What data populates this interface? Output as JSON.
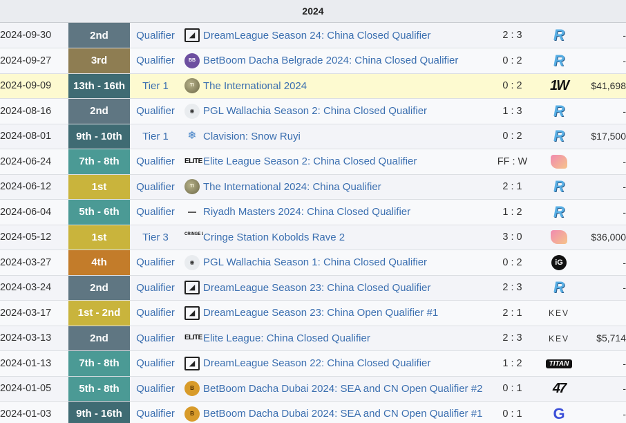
{
  "header": {
    "year": "2024"
  },
  "rows": [
    {
      "date": "2024-09-30",
      "place": "2nd",
      "place_class": "p-2nd",
      "tier": "Qualifier",
      "logo_class": "dl",
      "logo_icon": "dreamleague-icon",
      "logo_glyph": "◢",
      "name": "DreamLeague Season 24: China Closed Qualifier",
      "score": "2 : 3",
      "opp_class": "azure",
      "opp_icon": "azure-ray-logo-icon",
      "opp_glyph": "R",
      "prize": "-"
    },
    {
      "date": "2024-09-27",
      "place": "3rd",
      "place_class": "p-3rd",
      "tier": "Qualifier",
      "logo_class": "bb2",
      "logo_icon": "betboom-dacha-icon",
      "logo_glyph": "BB",
      "name": "BetBoom Dacha Belgrade 2024: China Closed Qualifier",
      "score": "0 : 2",
      "opp_class": "azure",
      "opp_icon": "azure-ray-logo-icon",
      "opp_glyph": "R",
      "prize": "-"
    },
    {
      "date": "2024-09-09",
      "place": "13th - 16th",
      "place_class": "p-dark",
      "tier": "Tier 1",
      "logo_class": "ti",
      "logo_icon": "the-international-icon",
      "logo_glyph": "TI",
      "name": "The International 2024",
      "score": "0 : 2",
      "opp_class": "w1",
      "opp_icon": "1win-logo-icon",
      "opp_glyph": "1W",
      "prize": "$41,698",
      "highlight": true
    },
    {
      "date": "2024-08-16",
      "place": "2nd",
      "place_class": "p-2nd",
      "tier": "Qualifier",
      "logo_class": "pgl",
      "logo_icon": "pgl-icon",
      "logo_glyph": "◉",
      "name": "PGL Wallachia Season 2: China Closed Qualifier",
      "score": "1 : 3",
      "opp_class": "azure",
      "opp_icon": "azure-ray-logo-icon",
      "opp_glyph": "R",
      "prize": "-"
    },
    {
      "date": "2024-08-01",
      "place": "9th - 10th",
      "place_class": "p-dark",
      "tier": "Tier 1",
      "logo_class": "clav",
      "logo_icon": "clavision-icon",
      "logo_glyph": "❄",
      "name": "Clavision: Snow Ruyi",
      "score": "0 : 2",
      "opp_class": "azure",
      "opp_icon": "azure-ray-logo-icon",
      "opp_glyph": "R",
      "prize": "$17,500"
    },
    {
      "date": "2024-06-24",
      "place": "7th - 8th",
      "place_class": "p-teal",
      "tier": "Qualifier",
      "logo_class": "elite",
      "logo_icon": "elite-league-icon",
      "logo_glyph": "ELITE",
      "name": "Elite League Season 2: China Closed Qualifier",
      "score": "FF : W",
      "opp_class": "pink",
      "opp_icon": "pink-team-logo-icon",
      "opp_glyph": "",
      "prize": "-"
    },
    {
      "date": "2024-06-12",
      "place": "1st",
      "place_class": "p-1st",
      "tier": "Qualifier",
      "logo_class": "ti",
      "logo_icon": "the-international-icon",
      "logo_glyph": "TI",
      "name": "The International 2024: China Qualifier",
      "score": "2 : 1",
      "opp_class": "azure",
      "opp_icon": "azure-ray-logo-icon",
      "opp_glyph": "R",
      "prize": "-"
    },
    {
      "date": "2024-06-04",
      "place": "5th - 6th",
      "place_class": "p-teal",
      "tier": "Qualifier",
      "logo_class": "rm",
      "logo_icon": "riyadh-masters-icon",
      "logo_glyph": "▬▬",
      "name": "Riyadh Masters 2024: China Closed Qualifier",
      "score": "1 : 2",
      "opp_class": "azure",
      "opp_icon": "azure-ray-logo-icon",
      "opp_glyph": "R",
      "prize": "-"
    },
    {
      "date": "2024-05-12",
      "place": "1st",
      "place_class": "p-1st",
      "tier": "Tier 3",
      "logo_class": "cs",
      "logo_icon": "cringe-station-icon",
      "logo_glyph": "CRINGE STATION",
      "name": "Cringe Station Kobolds Rave 2",
      "score": "3 : 0",
      "opp_class": "pink",
      "opp_icon": "pink-team-logo-icon",
      "opp_glyph": "",
      "prize": "$36,000"
    },
    {
      "date": "2024-03-27",
      "place": "4th",
      "place_class": "p-4th",
      "tier": "Qualifier",
      "logo_class": "pgl",
      "logo_icon": "pgl-icon",
      "logo_glyph": "◉",
      "name": "PGL Wallachia Season 1: China Closed Qualifier",
      "score": "0 : 2",
      "opp_class": "ig",
      "opp_icon": "invictus-gaming-logo-icon",
      "opp_glyph": "iG",
      "prize": "-"
    },
    {
      "date": "2024-03-24",
      "place": "2nd",
      "place_class": "p-2nd",
      "tier": "Qualifier",
      "logo_class": "dl",
      "logo_icon": "dreamleague-icon",
      "logo_glyph": "◢",
      "name": "DreamLeague Season 23: China Closed Qualifier",
      "score": "2 : 3",
      "opp_class": "azure",
      "opp_icon": "azure-ray-logo-icon",
      "opp_glyph": "R",
      "prize": "-"
    },
    {
      "date": "2024-03-17",
      "place": "1st - 2nd",
      "place_class": "p-1st",
      "tier": "Qualifier",
      "logo_class": "dl",
      "logo_icon": "dreamleague-icon",
      "logo_glyph": "◢",
      "name": "DreamLeague Season 23: China Open Qualifier #1",
      "score": "2 : 1",
      "opp_class": "kev",
      "opp_icon": "kev-logo-icon",
      "opp_glyph": "KEV",
      "prize": ""
    },
    {
      "date": "2024-03-13",
      "place": "2nd",
      "place_class": "p-2nd",
      "tier": "Qualifier",
      "logo_class": "elite",
      "logo_icon": "elite-league-icon",
      "logo_glyph": "ELITE",
      "name": "Elite League: China Closed Qualifier",
      "score": "2 : 3",
      "opp_class": "kev",
      "opp_icon": "kev-logo-icon",
      "opp_glyph": "KEV",
      "prize": "$5,714"
    },
    {
      "date": "2024-01-13",
      "place": "7th - 8th",
      "place_class": "p-teal",
      "tier": "Qualifier",
      "logo_class": "dl",
      "logo_icon": "dreamleague-icon",
      "logo_glyph": "◢",
      "name": "DreamLeague Season 22: China Closed Qualifier",
      "score": "1 : 2",
      "opp_class": "titan",
      "opp_icon": "titan-logo-icon",
      "opp_glyph": "TITAN",
      "prize": "-"
    },
    {
      "date": "2024-01-05",
      "place": "5th - 8th",
      "place_class": "p-teal",
      "tier": "Qualifier",
      "logo_class": "bb",
      "logo_icon": "betboom-dacha-icon",
      "logo_glyph": "B",
      "name": "BetBoom Dacha Dubai 2024: SEA and CN Open Qualifier #2",
      "score": "0 : 1",
      "opp_class": "f47",
      "opp_icon": "team-47-logo-icon",
      "opp_glyph": "47",
      "prize": "-"
    },
    {
      "date": "2024-01-03",
      "place": "9th - 16th",
      "place_class": "p-dark",
      "tier": "Qualifier",
      "logo_class": "bb",
      "logo_icon": "betboom-dacha-icon",
      "logo_glyph": "B",
      "name": "BetBoom Dacha Dubai 2024: SEA and CN Open Qualifier #1",
      "score": "0 : 1",
      "opp_class": "g",
      "opp_icon": "g-team-logo-icon",
      "opp_glyph": "G",
      "prize": "-"
    }
  ]
}
